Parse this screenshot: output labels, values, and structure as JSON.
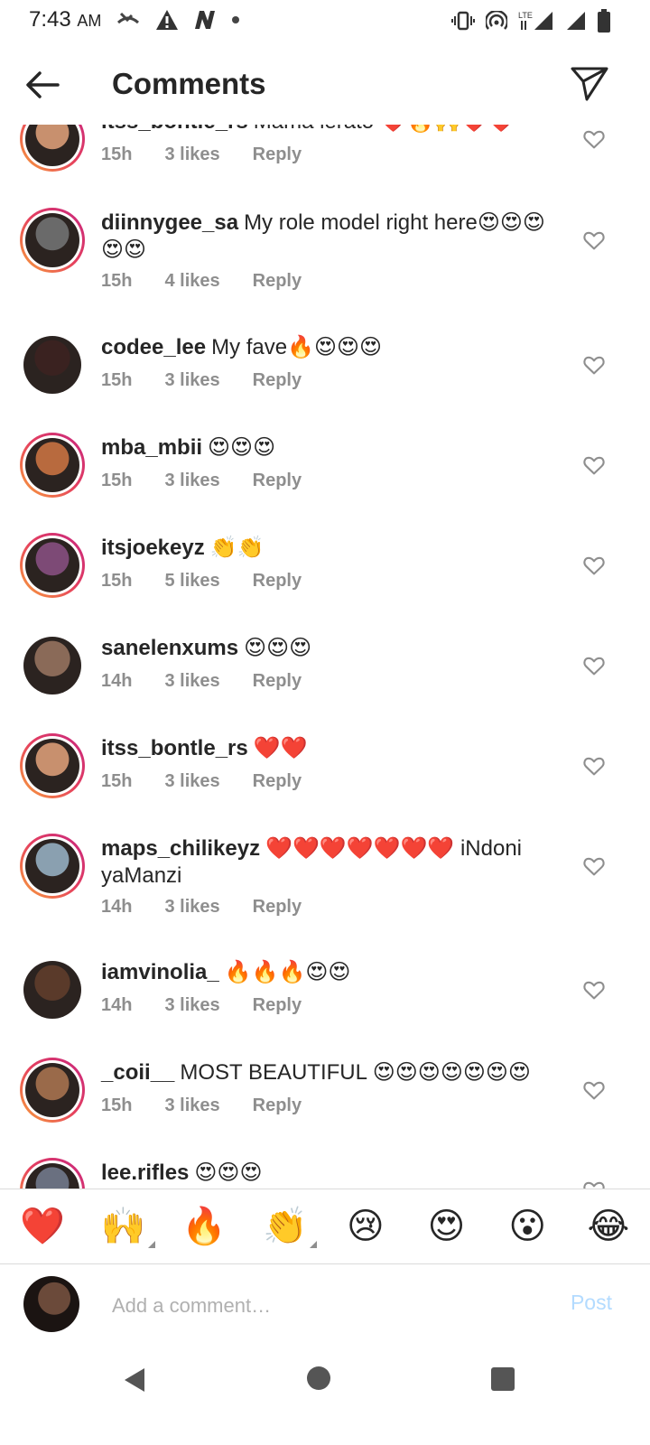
{
  "status_bar": {
    "time": "7:43",
    "ampm": "AM",
    "left_icons": [
      "missed-call-icon",
      "warning-icon",
      "n-app-icon",
      "dot-icon"
    ],
    "right_icons": [
      "vibrate-icon",
      "hotspot-icon",
      "lte-signal-icon",
      "signal-icon",
      "battery-icon"
    ]
  },
  "header": {
    "title": "Comments"
  },
  "comments": [
    {
      "user": "itss_bontle_rs",
      "text": "Mama lerato ❤️🔥🙌❤️❤️",
      "time": "15h",
      "likes": "3 likes",
      "reply": "Reply",
      "ring": true,
      "color": "#c8906e"
    },
    {
      "user": "diinnygee_sa",
      "text": "My role model right here😍😍😍😍😍",
      "time": "15h",
      "likes": "4 likes",
      "reply": "Reply",
      "ring": true,
      "color": "#6a6a6a"
    },
    {
      "user": "codee_lee",
      "text": "My fave🔥😍😍😍",
      "time": "15h",
      "likes": "3 likes",
      "reply": "Reply",
      "ring": false,
      "color": "#3a2220"
    },
    {
      "user": "mba_mbii",
      "text": "😍😍😍",
      "time": "15h",
      "likes": "3 likes",
      "reply": "Reply",
      "ring": true,
      "color": "#b86a3e"
    },
    {
      "user": "itsjoekeyz",
      "text": "👏👏",
      "time": "15h",
      "likes": "5 likes",
      "reply": "Reply",
      "ring": true,
      "color": "#7d4a76"
    },
    {
      "user": "sanelenxums",
      "text": "😍😍😍",
      "time": "14h",
      "likes": "3 likes",
      "reply": "Reply",
      "ring": false,
      "color": "#8a6a58"
    },
    {
      "user": "itss_bontle_rs",
      "text": "❤️❤️",
      "time": "15h",
      "likes": "3 likes",
      "reply": "Reply",
      "ring": true,
      "color": "#c8906e"
    },
    {
      "user": "maps_chilikeyz",
      "text": "❤️❤️❤️❤️❤️❤️❤️ iNdoni yaManzi",
      "time": "14h",
      "likes": "3 likes",
      "reply": "Reply",
      "ring": true,
      "color": "#8aa0b0"
    },
    {
      "user": "iamvinolia_",
      "text": "🔥🔥🔥😍😍",
      "time": "14h",
      "likes": "3 likes",
      "reply": "Reply",
      "ring": false,
      "color": "#5a3a2a"
    },
    {
      "user": "_coii__",
      "text": "MOST BEAUTIFUL 😍😍😍😍😍😍😍",
      "time": "15h",
      "likes": "3 likes",
      "reply": "Reply",
      "ring": true,
      "color": "#9a6a4a"
    },
    {
      "user": "lee.rifles",
      "text": "😍😍😍",
      "time": "",
      "likes": "",
      "reply": "",
      "ring": true,
      "color": "#6a7080"
    }
  ],
  "emoji_bar": [
    "❤️",
    "🙌",
    "🔥",
    "👏",
    "😢",
    "😍",
    "😮",
    "😂"
  ],
  "composer": {
    "placeholder": "Add a comment…",
    "post_label": "Post"
  }
}
